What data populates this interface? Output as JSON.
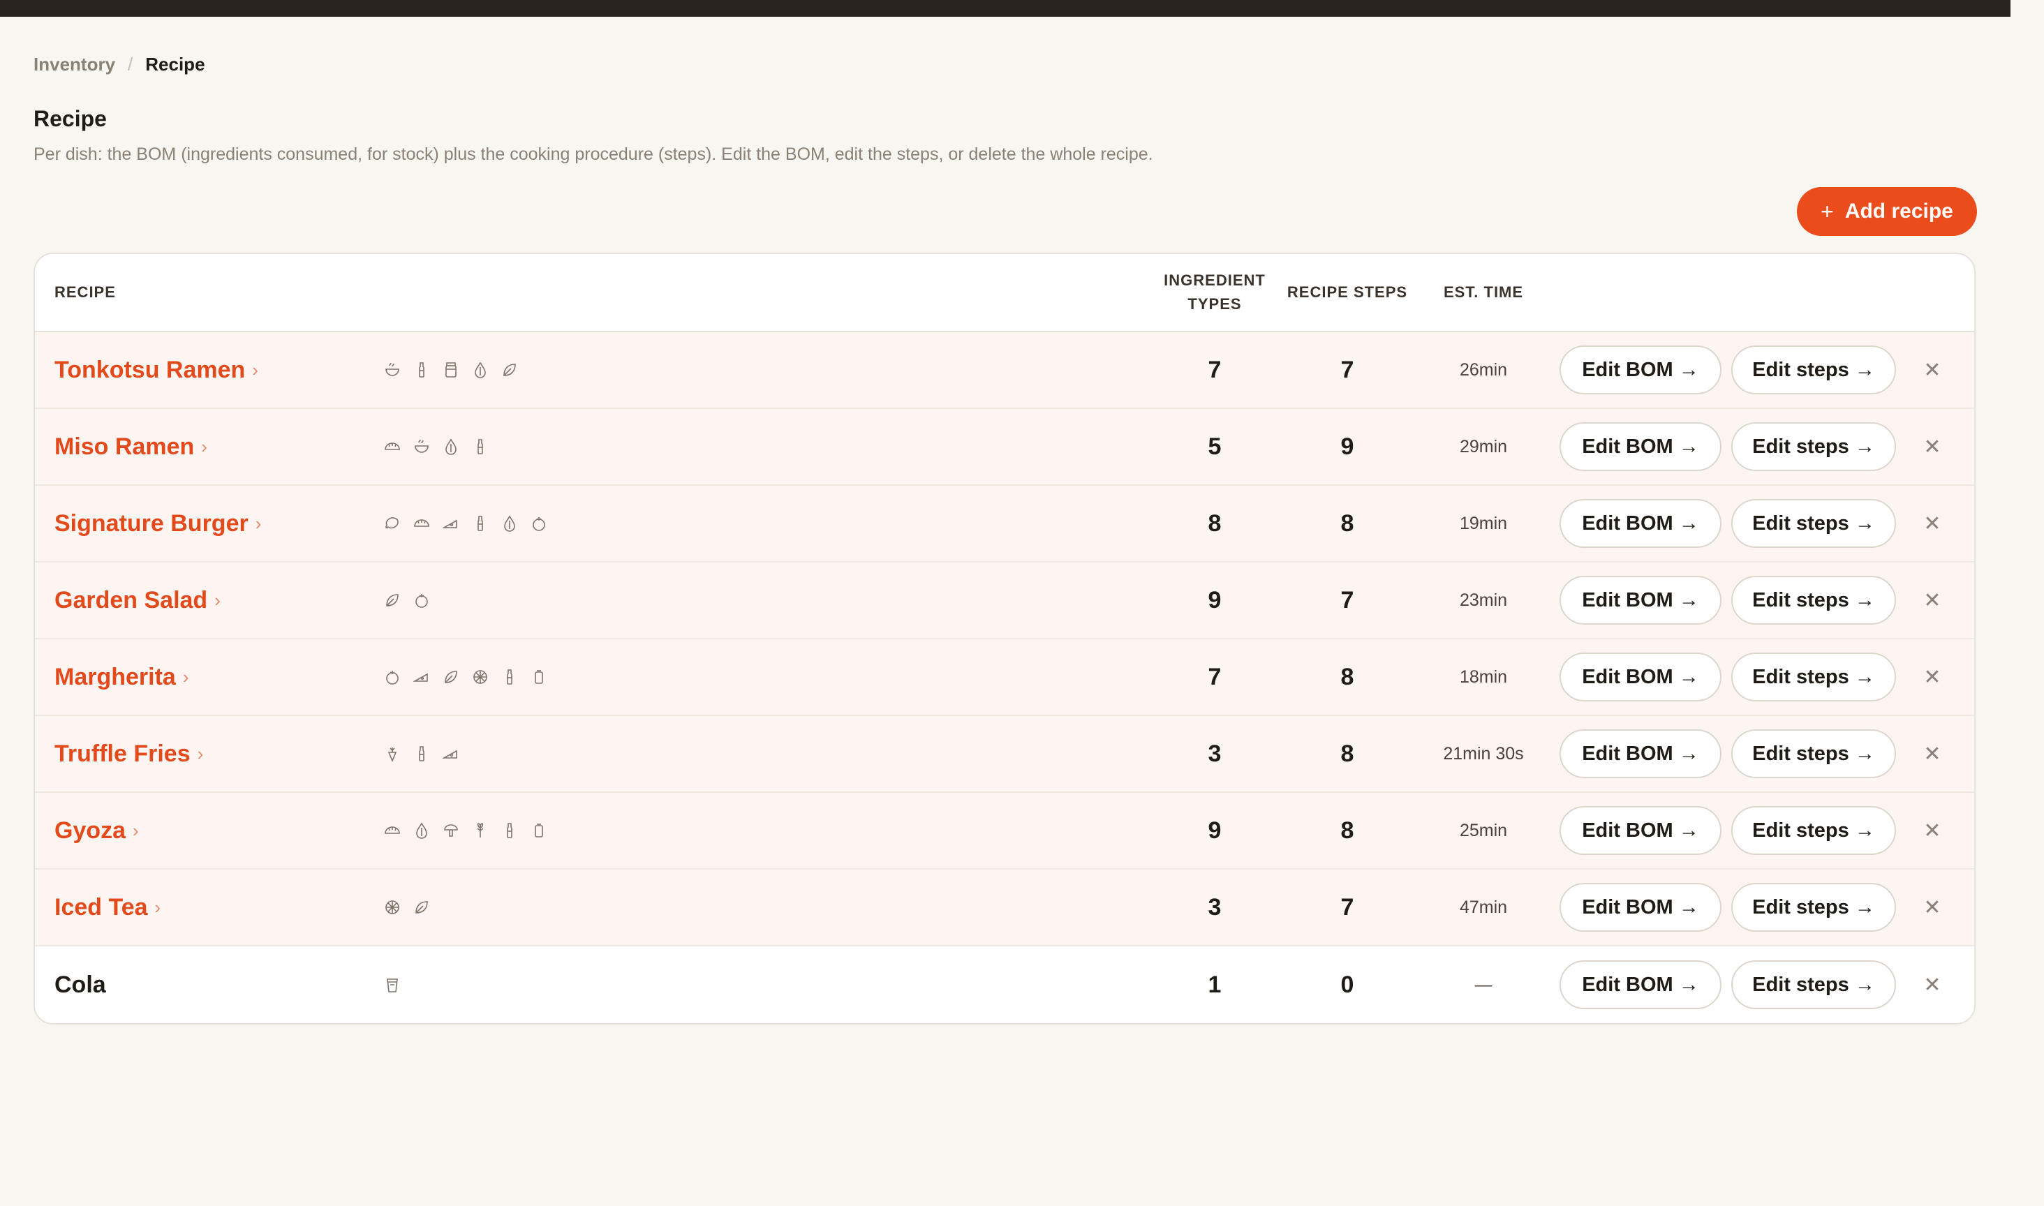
{
  "breadcrumb": {
    "parent": "Inventory",
    "separator": "/",
    "current": "Recipe"
  },
  "page": {
    "title": "Recipe",
    "description": "Per dish: the BOM (ingredients consumed, for stock) plus the cooking procedure (steps). Edit the BOM, edit the steps, or delete the whole recipe."
  },
  "actions": {
    "add_recipe": "Add recipe",
    "add_icon": "+"
  },
  "table": {
    "headers": {
      "recipe": "RECIPE",
      "ingredient_types_1": "INGREDIENT",
      "ingredient_types_2": "TYPES",
      "recipe_steps": "RECIPE STEPS",
      "est_time": "EST. TIME"
    },
    "edit_bom_label": "Edit BOM →",
    "edit_steps_label": "Edit steps →",
    "delete_glyph": "✕",
    "chevron_glyph": "›",
    "rows": [
      {
        "name": "Tonkotsu Ramen",
        "icons": [
          "bowl-icon",
          "bottle-icon",
          "jar-icon",
          "drop-icon",
          "leaf-icon"
        ],
        "ingredient_types": "7",
        "recipe_steps": "7",
        "est_time": "26min",
        "linked": true
      },
      {
        "name": "Miso Ramen",
        "icons": [
          "dumpling-icon",
          "bowl-icon",
          "drop-icon",
          "bottle-icon"
        ],
        "ingredient_types": "5",
        "recipe_steps": "9",
        "est_time": "29min",
        "linked": true
      },
      {
        "name": "Signature Burger",
        "icons": [
          "meat-icon",
          "dumpling-icon",
          "cheese-icon",
          "bottle-icon",
          "drop-icon",
          "tomato-icon"
        ],
        "ingredient_types": "8",
        "recipe_steps": "8",
        "est_time": "19min",
        "linked": true
      },
      {
        "name": "Garden Salad",
        "icons": [
          "leaf-icon",
          "tomato-icon"
        ],
        "ingredient_types": "9",
        "recipe_steps": "7",
        "est_time": "23min",
        "linked": true
      },
      {
        "name": "Margherita",
        "icons": [
          "tomato-icon",
          "cheese-icon",
          "leaf-icon",
          "citrus-icon",
          "bottle-icon",
          "can-icon"
        ],
        "ingredient_types": "7",
        "recipe_steps": "8",
        "est_time": "18min",
        "linked": true
      },
      {
        "name": "Truffle Fries",
        "icons": [
          "carrot-icon",
          "bottle-icon",
          "cheese-icon"
        ],
        "ingredient_types": "3",
        "recipe_steps": "8",
        "est_time": "21min 30s",
        "linked": true
      },
      {
        "name": "Gyoza",
        "icons": [
          "dumpling-icon",
          "drop-icon",
          "mushroom-icon",
          "herb-icon",
          "bottle-icon",
          "can-icon"
        ],
        "ingredient_types": "9",
        "recipe_steps": "8",
        "est_time": "25min",
        "linked": true
      },
      {
        "name": "Iced Tea",
        "icons": [
          "citrus-icon",
          "leaf-icon"
        ],
        "ingredient_types": "3",
        "recipe_steps": "7",
        "est_time": "47min",
        "linked": true
      },
      {
        "name": "Cola",
        "icons": [
          "cup-icon"
        ],
        "ingredient_types": "1",
        "recipe_steps": "0",
        "est_time": "—",
        "linked": false
      }
    ]
  },
  "colors": {
    "accent": "#ea4c1c",
    "row_tint": "#fdf5f2",
    "background": "#f8f6f1"
  }
}
